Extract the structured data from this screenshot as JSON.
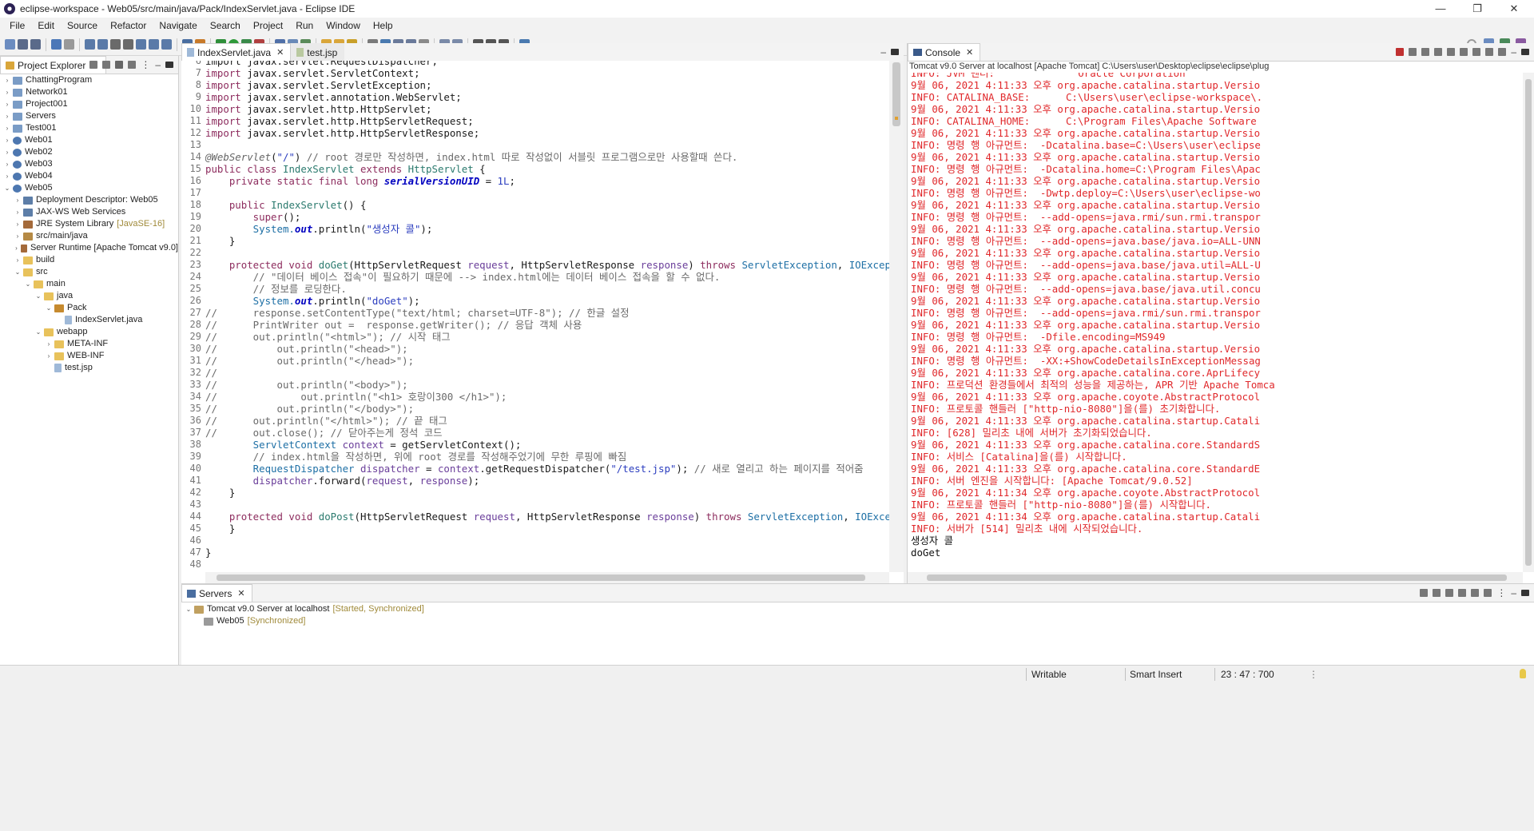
{
  "window": {
    "title": "eclipse-workspace - Web05/src/main/java/Pack/IndexServlet.java - Eclipse IDE",
    "controls": [
      "—",
      "❐",
      "✕"
    ]
  },
  "menu": [
    "File",
    "Edit",
    "Source",
    "Refactor",
    "Navigate",
    "Search",
    "Project",
    "Run",
    "Window",
    "Help"
  ],
  "explorer": {
    "tab_label": "Project Explorer",
    "items": [
      {
        "label": "ChattingProgram",
        "indent": 0,
        "icon": "project",
        "arrow": "›"
      },
      {
        "label": "Network01",
        "indent": 0,
        "icon": "project",
        "arrow": "›"
      },
      {
        "label": "Project001",
        "indent": 0,
        "icon": "project",
        "arrow": "›"
      },
      {
        "label": "Servers",
        "indent": 0,
        "icon": "project",
        "arrow": "›"
      },
      {
        "label": "Test001",
        "indent": 0,
        "icon": "project",
        "arrow": "›"
      },
      {
        "label": "Web01",
        "indent": 0,
        "icon": "web",
        "arrow": "›"
      },
      {
        "label": "Web02",
        "indent": 0,
        "icon": "web",
        "arrow": "›"
      },
      {
        "label": "Web03",
        "indent": 0,
        "icon": "web",
        "arrow": "›"
      },
      {
        "label": "Web04",
        "indent": 0,
        "icon": "web",
        "arrow": "›"
      },
      {
        "label": "Web05",
        "indent": 0,
        "icon": "web",
        "arrow": "⌄"
      },
      {
        "label": "Deployment Descriptor: Web05",
        "indent": 1,
        "icon": "desc",
        "arrow": "›"
      },
      {
        "label": "JAX-WS Web Services",
        "indent": 1,
        "icon": "desc",
        "arrow": "›"
      },
      {
        "label": "JRE System Library",
        "decoration": "[JavaSE-16]",
        "indent": 1,
        "icon": "lib",
        "arrow": "›"
      },
      {
        "label": "src/main/java",
        "indent": 1,
        "icon": "src",
        "arrow": "›"
      },
      {
        "label": "Server Runtime [Apache Tomcat v9.0]",
        "indent": 1,
        "icon": "lib",
        "arrow": "›"
      },
      {
        "label": "build",
        "indent": 1,
        "icon": "folder",
        "arrow": "›"
      },
      {
        "label": "src",
        "indent": 1,
        "icon": "folder",
        "arrow": "⌄"
      },
      {
        "label": "main",
        "indent": 2,
        "icon": "folder",
        "arrow": "⌄"
      },
      {
        "label": "java",
        "indent": 3,
        "icon": "folder",
        "arrow": "⌄"
      },
      {
        "label": "Pack",
        "indent": 4,
        "icon": "pkg",
        "arrow": "⌄"
      },
      {
        "label": "IndexServlet.java",
        "indent": 5,
        "icon": "file",
        "arrow": ""
      },
      {
        "label": "webapp",
        "indent": 3,
        "icon": "folder",
        "arrow": "⌄"
      },
      {
        "label": "META-INF",
        "indent": 4,
        "icon": "folder",
        "arrow": "›"
      },
      {
        "label": "WEB-INF",
        "indent": 4,
        "icon": "folder",
        "arrow": "›"
      },
      {
        "label": "test.jsp",
        "indent": 4,
        "icon": "file",
        "arrow": ""
      }
    ]
  },
  "editor": {
    "tabs": [
      "IndexServlet.java",
      "test.jsp"
    ],
    "lines": [
      {
        "n": "6",
        "code": [
          [
            "import javax.servlet.RequestDispatcher;",
            "mt"
          ]
        ]
      },
      {
        "n": "7",
        "code": [
          [
            "import ",
            "kw"
          ],
          [
            "javax.servlet.ServletContext;",
            "mt"
          ]
        ]
      },
      {
        "n": "8",
        "code": [
          [
            "import ",
            "kw"
          ],
          [
            "javax.servlet.ServletException;",
            "mt"
          ]
        ]
      },
      {
        "n": "9",
        "code": [
          [
            "import ",
            "kw"
          ],
          [
            "javax.servlet.annotation.WebServlet;",
            "mt"
          ]
        ]
      },
      {
        "n": "10",
        "code": [
          [
            "import ",
            "kw"
          ],
          [
            "javax.servlet.http.HttpServlet;",
            "mt"
          ]
        ]
      },
      {
        "n": "11",
        "code": [
          [
            "import ",
            "kw"
          ],
          [
            "javax.servlet.http.HttpServletRequest;",
            "mt"
          ]
        ]
      },
      {
        "n": "12",
        "code": [
          [
            "import ",
            "kw"
          ],
          [
            "javax.servlet.http.HttpServletResponse;",
            "mt"
          ]
        ]
      },
      {
        "n": "13",
        "code": []
      },
      {
        "n": "14",
        "code": [
          [
            "@WebServlet",
            "an"
          ],
          [
            "(",
            "mt"
          ],
          [
            "\"/\"",
            "str"
          ],
          [
            ") ",
            "mt"
          ],
          [
            "// root 경로만 작성하면, index.html 따로 작성없이 서블릿 프로그램으로만 사용할때 쓴다.",
            "cm"
          ]
        ]
      },
      {
        "n": "15",
        "code": [
          [
            "public class ",
            "kw"
          ],
          [
            "IndexServlet ",
            "cls"
          ],
          [
            "extends ",
            "kw"
          ],
          [
            "HttpServlet",
            "cls"
          ],
          [
            " {",
            "mt"
          ]
        ]
      },
      {
        "n": "16",
        "code": [
          [
            "    private static final long ",
            "kw"
          ],
          [
            "serialVersionUID",
            "fd"
          ],
          [
            " = ",
            "mt"
          ],
          [
            "1L",
            "str"
          ],
          [
            ";",
            "mt"
          ]
        ]
      },
      {
        "n": "17",
        "code": []
      },
      {
        "n": "18",
        "code": [
          [
            "    public ",
            "kw"
          ],
          [
            "IndexServlet",
            "cls"
          ],
          [
            "() {",
            "mt"
          ]
        ]
      },
      {
        "n": "19",
        "code": [
          [
            "        super",
            "kw"
          ],
          [
            "();",
            "mt"
          ]
        ]
      },
      {
        "n": "20",
        "code": [
          [
            "        System.",
            "ty"
          ],
          [
            "out",
            "fd"
          ],
          [
            ".println(",
            "mt"
          ],
          [
            "\"생성자 콜\"",
            "str"
          ],
          [
            ");",
            "mt"
          ]
        ]
      },
      {
        "n": "21",
        "code": [
          [
            "    }",
            "mt"
          ]
        ]
      },
      {
        "n": "22",
        "code": []
      },
      {
        "n": "23",
        "code": [
          [
            "    protected void ",
            "kw"
          ],
          [
            "doGet",
            "cls"
          ],
          [
            "(HttpServletRequest ",
            "mt"
          ],
          [
            "request",
            "prm"
          ],
          [
            ", HttpServletResponse ",
            "mt"
          ],
          [
            "response",
            "prm"
          ],
          [
            ") ",
            "mt"
          ],
          [
            "throws ",
            "kw"
          ],
          [
            "ServletException",
            "ty"
          ],
          [
            ", ",
            "mt"
          ],
          [
            "IOException",
            "ty"
          ]
        ]
      },
      {
        "n": "24",
        "code": [
          [
            "        // \"데이터 베이스 접속\"이 필요하기 때문에 --> index.html에는 데이터 베이스 접속을 할 수 없다.",
            "cm"
          ]
        ]
      },
      {
        "n": "25",
        "code": [
          [
            "        // 정보를 로딩한다.",
            "cm"
          ]
        ]
      },
      {
        "n": "26",
        "code": [
          [
            "        System.",
            "ty"
          ],
          [
            "out",
            "fd"
          ],
          [
            ".println(",
            "mt"
          ],
          [
            "\"doGet\"",
            "str"
          ],
          [
            ");",
            "mt"
          ]
        ]
      },
      {
        "n": "27",
        "code": [
          [
            "//      response.setContentType(\"text/html; charset=UTF-8\"); // 한글 설정",
            "cm"
          ]
        ]
      },
      {
        "n": "28",
        "code": [
          [
            "//      PrintWriter out =  response.getWriter(); // 응답 객체 사용",
            "cm"
          ]
        ]
      },
      {
        "n": "29",
        "code": [
          [
            "//      out.println(\"<html>\"); // 시작 태그",
            "cm"
          ]
        ]
      },
      {
        "n": "30",
        "code": [
          [
            "//          out.println(\"<head>\");",
            "cm"
          ]
        ]
      },
      {
        "n": "31",
        "code": [
          [
            "//          out.println(\"</head>\");",
            "cm"
          ]
        ]
      },
      {
        "n": "32",
        "code": [
          [
            "//",
            "cm"
          ]
        ]
      },
      {
        "n": "33",
        "code": [
          [
            "//          out.println(\"<body>\");",
            "cm"
          ]
        ]
      },
      {
        "n": "34",
        "code": [
          [
            "//              out.println(\"<h1> 호랑이300 </h1>\");",
            "cm"
          ]
        ]
      },
      {
        "n": "35",
        "code": [
          [
            "//          out.println(\"</body>\");",
            "cm"
          ]
        ]
      },
      {
        "n": "36",
        "code": [
          [
            "//      out.println(\"</html>\"); // 끝 태그",
            "cm"
          ]
        ]
      },
      {
        "n": "37",
        "code": [
          [
            "//      out.close(); // 닫아주는게 정석 코드",
            "cm"
          ]
        ]
      },
      {
        "n": "38",
        "code": [
          [
            "        ServletContext ",
            "ty"
          ],
          [
            "context",
            "prm"
          ],
          [
            " = getServletContext();",
            "mt"
          ]
        ]
      },
      {
        "n": "39",
        "code": [
          [
            "        // index.html을 작성하면, 위에 root 경로를 작성해주었기에 무한 루핑에 빠짐",
            "cm"
          ]
        ]
      },
      {
        "n": "40",
        "code": [
          [
            "        RequestDispatcher ",
            "ty"
          ],
          [
            "dispatcher",
            "prm"
          ],
          [
            " = ",
            "mt"
          ],
          [
            "context",
            "prm"
          ],
          [
            ".getRequestDispatcher(",
            "mt"
          ],
          [
            "\"/test.jsp\"",
            "str"
          ],
          [
            "); ",
            "mt"
          ],
          [
            "// 새로 열리고 하는 페이지를 적어줌",
            "cm"
          ]
        ]
      },
      {
        "n": "41",
        "code": [
          [
            "        dispatcher",
            "prm"
          ],
          [
            ".forward(",
            "mt"
          ],
          [
            "request",
            "prm"
          ],
          [
            ", ",
            "mt"
          ],
          [
            "response",
            "prm"
          ],
          [
            ");",
            "mt"
          ]
        ]
      },
      {
        "n": "42",
        "code": [
          [
            "    }",
            "mt"
          ]
        ]
      },
      {
        "n": "43",
        "code": []
      },
      {
        "n": "44",
        "code": [
          [
            "    protected void ",
            "kw"
          ],
          [
            "doPost",
            "cls"
          ],
          [
            "(HttpServletRequest ",
            "mt"
          ],
          [
            "request",
            "prm"
          ],
          [
            ", HttpServletResponse ",
            "mt"
          ],
          [
            "response",
            "prm"
          ],
          [
            ") ",
            "mt"
          ],
          [
            "throws ",
            "kw"
          ],
          [
            "ServletException",
            "ty"
          ],
          [
            ", ",
            "mt"
          ],
          [
            "IOExceptio",
            "ty"
          ]
        ]
      },
      {
        "n": "45",
        "code": [
          [
            "    }",
            "mt"
          ]
        ]
      },
      {
        "n": "46",
        "code": []
      },
      {
        "n": "47",
        "code": [
          [
            "}",
            "mt"
          ]
        ]
      },
      {
        "n": "48",
        "code": []
      }
    ]
  },
  "console": {
    "tab_label": "Console",
    "header": "Tomcat v9.0 Server at localhost [Apache Tomcat] C:\\Users\\user\\Desktop\\eclipse\\eclipse\\plug",
    "lines": [
      [
        "INFO: JVM 벤더:              Oracle Corporation",
        ""
      ],
      [
        "9월 06, 2021 4:11:33 오후 org.apache.catalina.startup.Versio",
        ""
      ],
      [
        "INFO: CATALINA_BASE:      C:\\Users\\user\\eclipse-workspace\\.",
        ""
      ],
      [
        "9월 06, 2021 4:11:33 오후 org.apache.catalina.startup.Versio",
        ""
      ],
      [
        "INFO: CATALINA_HOME:      C:\\Program Files\\Apache Software",
        ""
      ],
      [
        "9월 06, 2021 4:11:33 오후 org.apache.catalina.startup.Versio",
        ""
      ],
      [
        "INFO: 명령 행 아규먼트:  -Dcatalina.base=C:\\Users\\user\\eclipse",
        ""
      ],
      [
        "9월 06, 2021 4:11:33 오후 org.apache.catalina.startup.Versio",
        ""
      ],
      [
        "INFO: 명령 행 아규먼트:  -Dcatalina.home=C:\\Program Files\\Apac",
        ""
      ],
      [
        "9월 06, 2021 4:11:33 오후 org.apache.catalina.startup.Versio",
        ""
      ],
      [
        "INFO: 명령 행 아규먼트:  -Dwtp.deploy=C:\\Users\\user\\eclipse-wo",
        ""
      ],
      [
        "9월 06, 2021 4:11:33 오후 org.apache.catalina.startup.Versio",
        ""
      ],
      [
        "INFO: 명령 행 아규먼트:  --add-opens=java.rmi/sun.rmi.transpor",
        ""
      ],
      [
        "9월 06, 2021 4:11:33 오후 org.apache.catalina.startup.Versio",
        ""
      ],
      [
        "INFO: 명령 행 아규먼트:  --add-opens=java.base/java.io=ALL-UNN",
        ""
      ],
      [
        "9월 06, 2021 4:11:33 오후 org.apache.catalina.startup.Versio",
        ""
      ],
      [
        "INFO: 명령 행 아규먼트:  --add-opens=java.base/java.util=ALL-U",
        ""
      ],
      [
        "9월 06, 2021 4:11:33 오후 org.apache.catalina.startup.Versio",
        ""
      ],
      [
        "INFO: 명령 행 아규먼트:  --add-opens=java.base/java.util.concu",
        ""
      ],
      [
        "9월 06, 2021 4:11:33 오후 org.apache.catalina.startup.Versio",
        ""
      ],
      [
        "INFO: 명령 행 아규먼트:  --add-opens=java.rmi/sun.rmi.transpor",
        ""
      ],
      [
        "9월 06, 2021 4:11:33 오후 org.apache.catalina.startup.Versio",
        ""
      ],
      [
        "INFO: 명령 행 아규먼트:  -Dfile.encoding=MS949",
        ""
      ],
      [
        "9월 06, 2021 4:11:33 오후 org.apache.catalina.startup.Versio",
        ""
      ],
      [
        "INFO: 명령 행 아규먼트:  -XX:+ShowCodeDetailsInExceptionMessag",
        ""
      ],
      [
        "9월 06, 2021 4:11:33 오후 org.apache.catalina.core.AprLifecy",
        ""
      ],
      [
        "INFO: 프로덕션 환경들에서 최적의 성능을 제공하는, APR 기반 Apache Tomca",
        ""
      ],
      [
        "9월 06, 2021 4:11:33 오후 org.apache.coyote.AbstractProtocol",
        ""
      ],
      [
        "INFO: 프로토콜 핸들러 [\"http-nio-8080\"]을(를) 초기화합니다.",
        ""
      ],
      [
        "9월 06, 2021 4:11:33 오후 org.apache.catalina.startup.Catali",
        ""
      ],
      [
        "INFO: [628] 밀리초 내에 서버가 초기화되었습니다.",
        ""
      ],
      [
        "9월 06, 2021 4:11:33 오후 org.apache.catalina.core.StandardS",
        ""
      ],
      [
        "INFO: 서비스 [Catalina]을(를) 시작합니다.",
        ""
      ],
      [
        "9월 06, 2021 4:11:33 오후 org.apache.catalina.core.StandardE",
        ""
      ],
      [
        "INFO: 서버 엔진을 시작합니다: [Apache Tomcat/9.0.52]",
        ""
      ],
      [
        "9월 06, 2021 4:11:34 오후 org.apache.coyote.AbstractProtocol",
        ""
      ],
      [
        "INFO: 프로토콜 핸들러 [\"http-nio-8080\"]을(를) 시작합니다.",
        ""
      ],
      [
        "9월 06, 2021 4:11:34 오후 org.apache.catalina.startup.Catali",
        ""
      ],
      [
        "INFO: 서버가 [514] 밀리초 내에 시작되었습니다.",
        ""
      ],
      [
        "생성자 콜",
        "blk"
      ],
      [
        "doGet",
        "blk"
      ]
    ]
  },
  "servers": {
    "tab_label": "Servers",
    "server": "Tomcat v9.0 Server at localhost",
    "server_status": "[Started, Synchronized]",
    "module": "Web05",
    "module_status": "[Synchronized]"
  },
  "status": {
    "mode": "Writable",
    "insert": "Smart Insert",
    "position": "23 : 47 : 700"
  },
  "colors": {
    "keyword": "#8d2c5e",
    "string": "#2b3dbf",
    "comment": "#6a6a6a",
    "console_err": "#e0282b",
    "decoration": "#a08a3a"
  }
}
